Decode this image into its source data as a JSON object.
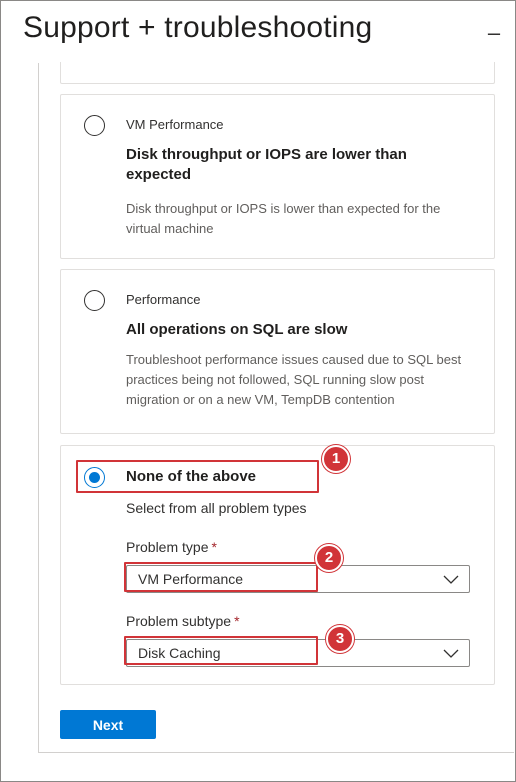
{
  "header": {
    "title": "Support + troubleshooting",
    "minimize_label": "–"
  },
  "options": [
    {
      "category": "VM Performance",
      "title": "Disk throughput or IOPS are lower than expected",
      "description": "Disk throughput or IOPS is lower than expected for the virtual machine",
      "selected": false
    },
    {
      "category": "Performance",
      "title": "All operations on SQL are slow",
      "description": "Troubleshoot performance issues caused due to SQL best practices being not followed, SQL running slow post migration or on a new VM, TempDB contention",
      "selected": false
    },
    {
      "title": "None of the above",
      "description": "Select from all problem types",
      "selected": true
    }
  ],
  "problem_type": {
    "label": "Problem type",
    "required_mark": "*",
    "value": "VM Performance"
  },
  "problem_subtype": {
    "label": "Problem subtype",
    "required_mark": "*",
    "value": "Disk Caching"
  },
  "annotations": {
    "badge1": "1",
    "badge2": "2",
    "badge3": "3",
    "color": "#d13438"
  },
  "actions": {
    "next_label": "Next"
  },
  "colors": {
    "accent": "#0078d4",
    "required": "#a4262c"
  }
}
